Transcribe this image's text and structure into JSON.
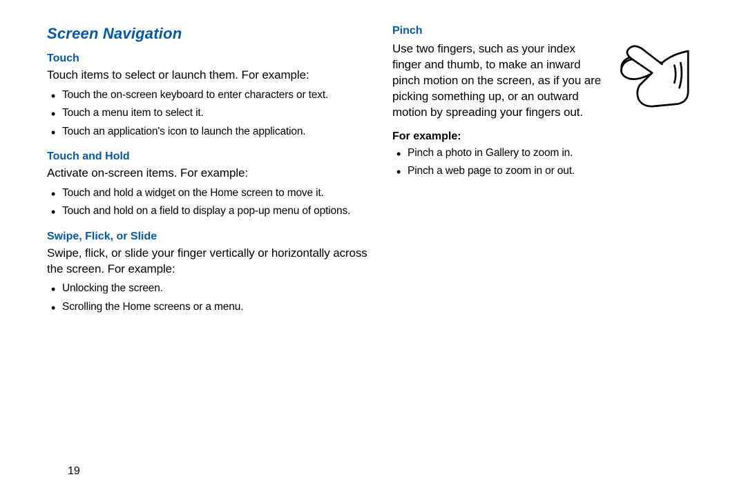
{
  "title": "Screen Navigation",
  "page_number": "19",
  "left": {
    "touch": {
      "heading": "Touch",
      "intro": "Touch items to select or launch them. For example:",
      "items": [
        "Touch the on-screen keyboard to enter characters or text.",
        "Touch a menu item to select it.",
        "Touch an application's icon to launch the application."
      ]
    },
    "touch_hold": {
      "heading": "Touch and Hold",
      "intro": "Activate on-screen items. For example:",
      "items": [
        "Touch and hold a widget on the Home screen to move it.",
        "Touch and hold on a field to display a pop-up menu of options."
      ]
    },
    "swipe": {
      "heading": "Swipe, Flick, or Slide",
      "intro": "Swipe, flick, or slide your finger vertically or horizontally across the screen. For example:",
      "items": [
        "Unlocking the screen.",
        "Scrolling the Home screens or a menu."
      ]
    }
  },
  "right": {
    "pinch": {
      "heading": "Pinch",
      "intro": "Use two fingers, such as your index finger and thumb, to make an inward pinch motion on the screen, as if you are picking something up, or an outward motion by spreading your fingers out.",
      "example_label": "For example:",
      "items": [
        "Pinch a photo in Gallery to zoom in.",
        "Pinch a web page to zoom in or out."
      ]
    }
  }
}
